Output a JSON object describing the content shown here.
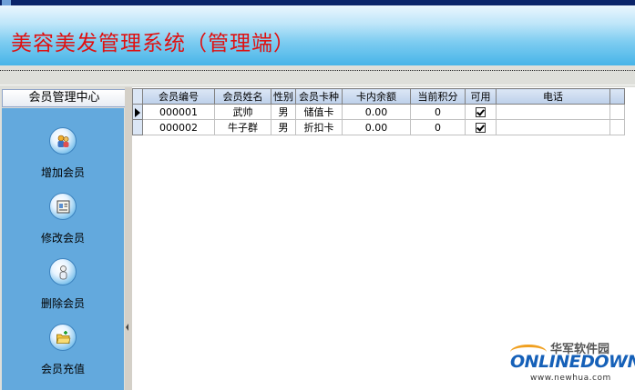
{
  "app": {
    "title": "美容美发管理系统（管理端）"
  },
  "sidebar": {
    "header": "会员管理中心",
    "items": [
      {
        "label": "增加会员",
        "icon": "users-icon"
      },
      {
        "label": "修改会员",
        "icon": "edit-card-icon"
      },
      {
        "label": "删除会员",
        "icon": "person-remove-icon"
      },
      {
        "label": "会员充值",
        "icon": "folder-add-icon"
      }
    ]
  },
  "grid": {
    "columns": [
      "会员编号",
      "会员姓名",
      "性别",
      "会员卡种",
      "卡内余额",
      "当前积分",
      "可用",
      "电话"
    ],
    "rows": [
      {
        "id": "000001",
        "name": "武帅",
        "gender": "男",
        "card_type": "储值卡",
        "balance": "0.00",
        "points": "0",
        "enabled": true,
        "phone": ""
      },
      {
        "id": "000002",
        "name": "牛子群",
        "gender": "男",
        "card_type": "折扣卡",
        "balance": "0.00",
        "points": "0",
        "enabled": true,
        "phone": ""
      }
    ]
  },
  "watermark": {
    "cn": "华军软件园",
    "logo": "ONLINEDOWN",
    "url": "www.newhua.com"
  },
  "colors": {
    "title": "#e01010",
    "sidebar": "#63a9dd",
    "banner": "#47b4e8"
  }
}
